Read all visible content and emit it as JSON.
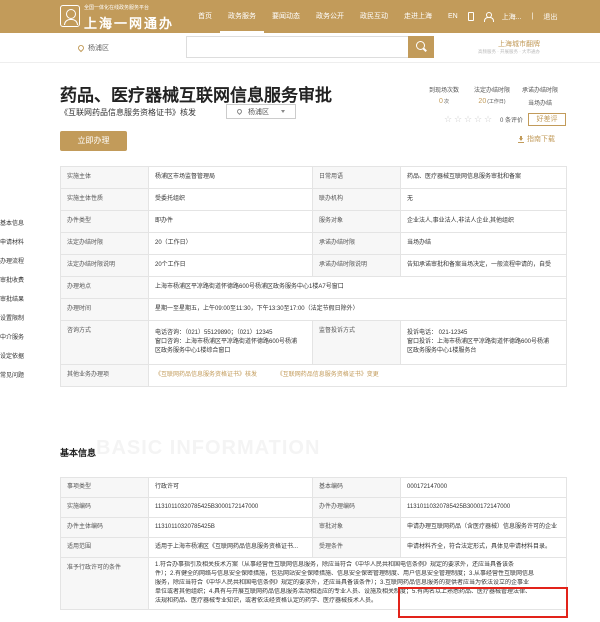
{
  "header": {
    "logo_sub": "全国一体化在线政务服务平台",
    "logo_title": "上海一网通办",
    "nav": [
      "首页",
      "政务服务",
      "要闻动态",
      "政务公开",
      "政民互动",
      "走进上海"
    ],
    "lang": "EN",
    "user": "上海...",
    "logout": "退出"
  },
  "search": {
    "location": "杨浦区",
    "hot_title": "上海城市翻牌",
    "hot_sub": "高频服务 · 开展服务 · 大市通办"
  },
  "service": {
    "title": "药品、医疗器械互联网信息服务审批",
    "subtitle": "《互联网药品信息服务资格证书》核发",
    "district": "杨浦区",
    "stats": [
      {
        "label": "到现场次数",
        "value": "0",
        "unit": "次"
      },
      {
        "label": "法定办结时限",
        "value": "20",
        "unit": "(工作日)"
      },
      {
        "label": "承诺办结时限",
        "value": "当场办结",
        "unit": ""
      }
    ],
    "rating_count": "0 条评价",
    "rate_button": "好差评",
    "apply_button": "立即办理",
    "download": "指南下载"
  },
  "side_nav": [
    "基本信息",
    "申请材料",
    "办理流程",
    "审批收费",
    "审批结果",
    "设置限制",
    "中介服务",
    "设定依据",
    "常见问题"
  ],
  "info_table": [
    {
      "k1": "实施主体",
      "v1": "杨浦区市场监督管理局",
      "k2": "日常用语",
      "v2": "药品、医疗器械互联网信息服务审批和备案"
    },
    {
      "k1": "实施主体性质",
      "v1": "受委托组织",
      "k2": "联办机构",
      "v2": "无"
    },
    {
      "k1": "办件类型",
      "v1": "即办件",
      "k2": "服务对象",
      "v2": "企业法人,事业法人,非法人企业,其他组织"
    },
    {
      "k1": "法定办结时限",
      "v1": "20（工作日）",
      "k2": "承诺办结时限",
      "v2": "当场办结"
    },
    {
      "k1": "法定办结时限说明",
      "v1": "20个工作日",
      "k2": "承诺办结时限说明",
      "v2": "告知承诺审批和备案当场决定，一般流程申请的，自受"
    }
  ],
  "place": {
    "k": "办理地点",
    "v": "上海市杨浦区平凉路街道怀德路600号杨浦区政务服务中心1楼A7号窗口"
  },
  "hours": {
    "k": "办理时间",
    "v": "星期一至星期五，上午09:00至11:30，下午13:30至17:00（法定节假日除外）"
  },
  "consult": {
    "k": "咨询方式",
    "lines": [
      "电话咨询：（021）55129890；（021）12345",
      "窗口咨询：上海市杨浦区平凉路街道怀德路600号杨浦",
      "区政务服务中心1楼综合窗口"
    ],
    "k2": "监督投诉方式",
    "lines2": [
      "投诉电话： 021-12345",
      "窗口投诉：上海市杨浦区平凉路街道怀德路600号杨浦",
      "区政务服务中心1楼服务台"
    ]
  },
  "other": {
    "k": "其他业务办理项",
    "links": [
      "《互联网药品信息服务资格证书》核发",
      "《互联网药品信息服务资格证书》变更"
    ]
  },
  "basic": {
    "title": "基本信息",
    "bg": "BASIC INFORMATION",
    "rows": [
      {
        "k1": "事项类型",
        "v1": "行政许可",
        "k2": "基本编码",
        "v2": "000172147000"
      },
      {
        "k1": "实施编码",
        "v1": "11310110320785425B3000172147000",
        "k2": "办件办理编码",
        "v2": "11310110320785425B3000172147000"
      },
      {
        "k1": "办件主体编码",
        "v1": "11310110320785425B",
        "k2": "审批对象",
        "v2": "申请办理互联网药品（含医疗器械）信息服务许可的企业"
      },
      {
        "k1": "适用范围",
        "v1": "适用于上海市杨浦区《互联网药品信息服务资格证书...",
        "k2": "受理条件",
        "v2": "申请材料齐全，符合法定形式，具体见申请材料目录。"
      }
    ],
    "condition_k": "准予行政许可的条件",
    "condition_lines": [
      "1.符合办事指引及相关技术方案（从事经营性互联网信息服务，除应当符合《中华人民共和国电信条例》规定的要求外，还应当具备该条",
      "件）；2.有健全的网络与信息安全保障措施，包括网站安全保障措施、信息安全保密管理制度、用户信息安全管理制度；3.从事经营性互联网信息",
      "服务，除应当符合《中华人民共和国电信条例》规定的要求外，还应当具备该条件）；3.互联网药品信息服务的提供者应当为依法设立的企事业",
      "单位或者其他组织；4.具有与开展互联网药品信息服务活动相适应的专业人员、设施及相关制度；5.有两名以上熟悉药品、医疗器械管理法律、",
      "法规和药品、医疗器械专业知识，或者依法经资格认定的药学、医疗器械技术人员。"
    ]
  }
}
